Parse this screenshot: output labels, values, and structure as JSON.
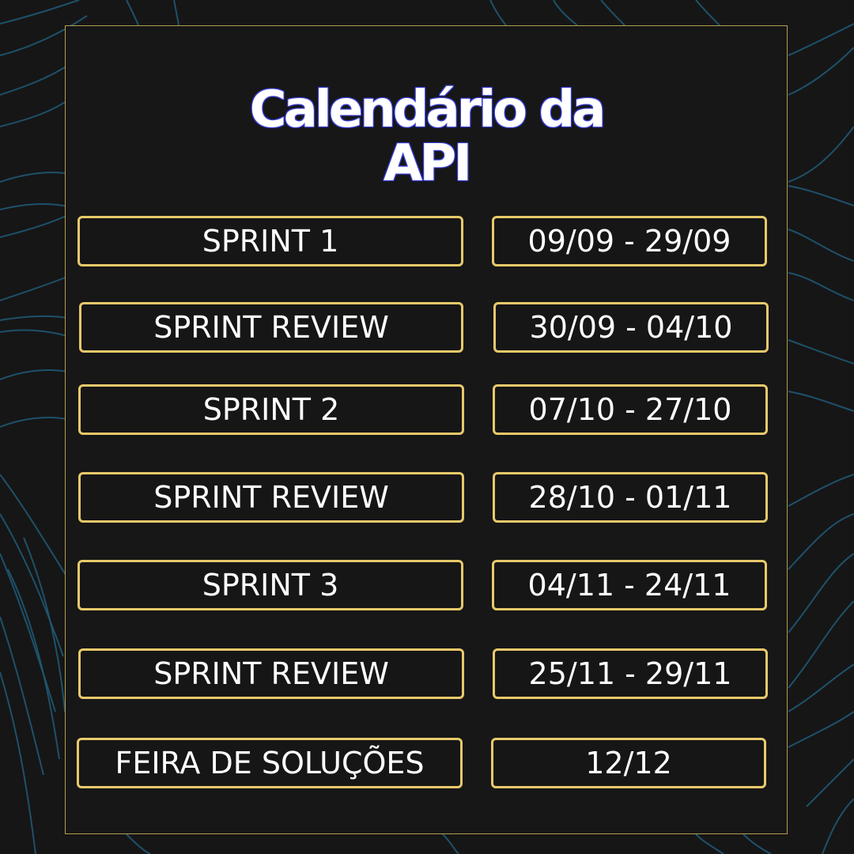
{
  "title": {
    "line1": "Calendário da",
    "line2": "API"
  },
  "schedule": [
    {
      "label": "SPRINT 1",
      "dates": "09/09 - 29/09"
    },
    {
      "label": "SPRINT REVIEW",
      "dates": "30/09 - 04/10"
    },
    {
      "label": "SPRINT 2",
      "dates": "07/10 - 27/10"
    },
    {
      "label": "SPRINT REVIEW",
      "dates": "28/10 - 01/11"
    },
    {
      "label": "SPRINT 3",
      "dates": "04/11 - 24/11"
    },
    {
      "label": "SPRINT REVIEW",
      "dates": "25/11 - 29/11"
    },
    {
      "label": "FEIRA DE SOLUÇÕES",
      "dates": "12/12"
    }
  ],
  "colors": {
    "background": "#161616",
    "accent_border": "#e8c96a",
    "panel_border": "#b59e4c",
    "wave_lines": "#1f5873",
    "text": "#ffffff",
    "title_outline": "#3a3fd8"
  }
}
